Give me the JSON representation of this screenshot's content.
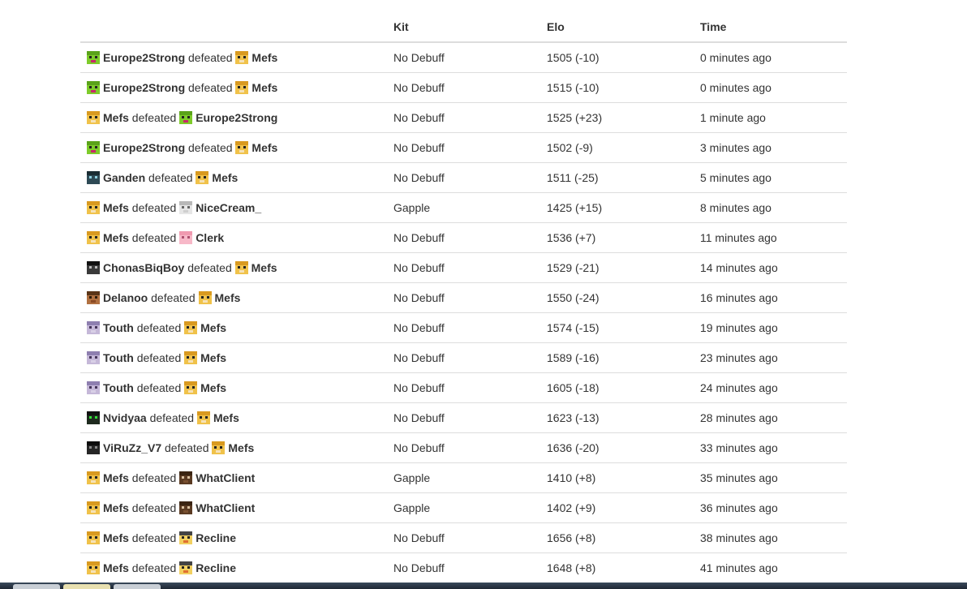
{
  "table": {
    "headers": {
      "match": "",
      "kit": "Kit",
      "elo": "Elo",
      "time": "Time"
    },
    "verb": "defeated",
    "rows": [
      {
        "winner": "Europe2Strong",
        "w_icon": "green-face",
        "loser": "Mefs",
        "l_icon": "yellow-face",
        "kit": "No Debuff",
        "elo": "1505 (-10)",
        "time": "0 minutes ago"
      },
      {
        "winner": "Europe2Strong",
        "w_icon": "green-face",
        "loser": "Mefs",
        "l_icon": "yellow-face",
        "kit": "No Debuff",
        "elo": "1515 (-10)",
        "time": "0 minutes ago"
      },
      {
        "winner": "Mefs",
        "w_icon": "yellow-face",
        "loser": "Europe2Strong",
        "l_icon": "green-face",
        "kit": "No Debuff",
        "elo": "1525 (+23)",
        "time": "1 minute ago"
      },
      {
        "winner": "Europe2Strong",
        "w_icon": "green-face",
        "loser": "Mefs",
        "l_icon": "yellow-face",
        "kit": "No Debuff",
        "elo": "1502 (-9)",
        "time": "3 minutes ago"
      },
      {
        "winner": "Ganden",
        "w_icon": "dark-teal-face",
        "loser": "Mefs",
        "l_icon": "yellow-face",
        "kit": "No Debuff",
        "elo": "1511 (-25)",
        "time": "5 minutes ago"
      },
      {
        "winner": "Mefs",
        "w_icon": "yellow-face",
        "loser": "NiceCream_",
        "l_icon": "white-face",
        "kit": "Gapple",
        "elo": "1425 (+15)",
        "time": "8 minutes ago"
      },
      {
        "winner": "Mefs",
        "w_icon": "yellow-face",
        "loser": "Clerk",
        "l_icon": "pink-face",
        "kit": "No Debuff",
        "elo": "1536 (+7)",
        "time": "11 minutes ago"
      },
      {
        "winner": "ChonasBiqBoy",
        "w_icon": "black-face",
        "loser": "Mefs",
        "l_icon": "yellow-face",
        "kit": "No Debuff",
        "elo": "1529 (-21)",
        "time": "14 minutes ago"
      },
      {
        "winner": "Delanoo",
        "w_icon": "brown-face",
        "loser": "Mefs",
        "l_icon": "yellow-face",
        "kit": "No Debuff",
        "elo": "1550 (-24)",
        "time": "16 minutes ago"
      },
      {
        "winner": "Touth",
        "w_icon": "lavender-face",
        "loser": "Mefs",
        "l_icon": "yellow-face",
        "kit": "No Debuff",
        "elo": "1574 (-15)",
        "time": "19 minutes ago"
      },
      {
        "winner": "Touth",
        "w_icon": "lavender-face",
        "loser": "Mefs",
        "l_icon": "yellow-face",
        "kit": "No Debuff",
        "elo": "1589 (-16)",
        "time": "23 minutes ago"
      },
      {
        "winner": "Touth",
        "w_icon": "lavender-face",
        "loser": "Mefs",
        "l_icon": "yellow-face",
        "kit": "No Debuff",
        "elo": "1605 (-18)",
        "time": "24 minutes ago"
      },
      {
        "winner": "Nvidyaa",
        "w_icon": "green-eyes-face",
        "loser": "Mefs",
        "l_icon": "yellow-face",
        "kit": "No Debuff",
        "elo": "1623 (-13)",
        "time": "28 minutes ago"
      },
      {
        "winner": "ViRuZz_V7",
        "w_icon": "dark-face",
        "loser": "Mefs",
        "l_icon": "yellow-face",
        "kit": "No Debuff",
        "elo": "1636 (-20)",
        "time": "33 minutes ago"
      },
      {
        "winner": "Mefs",
        "w_icon": "yellow-face",
        "loser": "WhatClient",
        "l_icon": "dark-brown-face",
        "kit": "Gapple",
        "elo": "1410 (+8)",
        "time": "35 minutes ago"
      },
      {
        "winner": "Mefs",
        "w_icon": "yellow-face",
        "loser": "WhatClient",
        "l_icon": "dark-brown-face",
        "kit": "Gapple",
        "elo": "1402 (+9)",
        "time": "36 minutes ago"
      },
      {
        "winner": "Mefs",
        "w_icon": "yellow-face",
        "loser": "Recline",
        "l_icon": "checker-face",
        "kit": "No Debuff",
        "elo": "1656 (+8)",
        "time": "38 minutes ago"
      },
      {
        "winner": "Mefs",
        "w_icon": "yellow-face",
        "loser": "Recline",
        "l_icon": "checker-face",
        "kit": "No Debuff",
        "elo": "1648 (+8)",
        "time": "41 minutes ago"
      }
    ]
  },
  "icon_colors": {
    "green-face": {
      "bg": "#7ecb2a",
      "top": "#5aa31a",
      "eye": "#222222",
      "mouth": "#c8286a"
    },
    "yellow-face": {
      "bg": "#f0c24a",
      "top": "#d99a20",
      "eye": "#222222",
      "mouth": "#f6e2b8"
    },
    "dark-teal-face": {
      "bg": "#2e4a55",
      "top": "#1a2c33",
      "eye": "#8fd0e0",
      "mouth": "#2e4a55"
    },
    "white-face": {
      "bg": "#e6e6e6",
      "top": "#b8b8b8",
      "eye": "#666666",
      "mouth": "#cfcfcf"
    },
    "pink-face": {
      "bg": "#f7b8c8",
      "top": "#f09ab0",
      "eye": "#b05070",
      "mouth": "#f7b8c8"
    },
    "black-face": {
      "bg": "#3a3a3a",
      "top": "#111111",
      "eye": "#bbbbbb",
      "mouth": "#3a3a3a"
    },
    "brown-face": {
      "bg": "#b07040",
      "top": "#5a3518",
      "eye": "#2a1a0a",
      "mouth": "#8a4a24"
    },
    "lavender-face": {
      "bg": "#c5b8d8",
      "top": "#8e7fb0",
      "eye": "#44335a",
      "mouth": "#d8cfe6"
    },
    "green-eyes-face": {
      "bg": "#1e2a1e",
      "top": "#111111",
      "eye": "#36e03a",
      "mouth": "#1e2a1e"
    },
    "dark-face": {
      "bg": "#262626",
      "top": "#0d0d0d",
      "eye": "#8a8a8a",
      "mouth": "#262626"
    },
    "dark-brown-face": {
      "bg": "#5a3a22",
      "top": "#3a2412",
      "eye": "#d8c0a0",
      "mouth": "#7a5030"
    },
    "checker-face": {
      "bg": "#f2d060",
      "top": "#444444",
      "eye": "#222222",
      "mouth": "#e07030"
    }
  }
}
